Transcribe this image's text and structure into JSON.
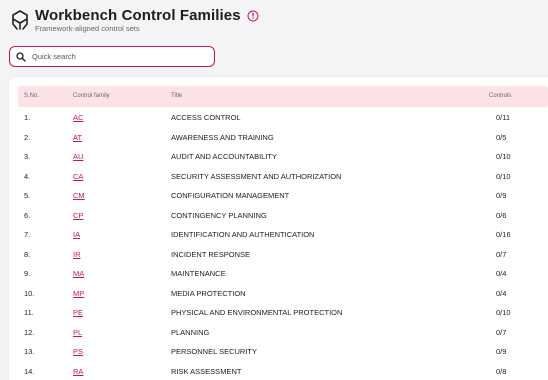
{
  "header": {
    "title": "Workbench Control Families",
    "subtitle": "Framework-aligned control sets"
  },
  "search": {
    "placeholder": "Quick search",
    "value": ""
  },
  "table": {
    "columns": [
      "S.No.",
      "Control family",
      "Title",
      "Controls"
    ],
    "rows": [
      {
        "no": "1.",
        "family": "AC",
        "title": "ACCESS CONTROL",
        "controls": "0/11"
      },
      {
        "no": "2.",
        "family": "AT",
        "title": "AWARENESS AND TRAINING",
        "controls": "0/5"
      },
      {
        "no": "3.",
        "family": "AU",
        "title": "AUDIT AND ACCOUNTABILITY",
        "controls": "0/10"
      },
      {
        "no": "4.",
        "family": "CA",
        "title": "SECURITY ASSESSMENT AND AUTHORIZATION",
        "controls": "0/10"
      },
      {
        "no": "5.",
        "family": "CM",
        "title": "CONFIGURATION MANAGEMENT",
        "controls": "0/9"
      },
      {
        "no": "6.",
        "family": "CP",
        "title": "CONTINGENCY PLANNING",
        "controls": "0/6"
      },
      {
        "no": "7.",
        "family": "IA",
        "title": "IDENTIFICATION AND AUTHENTICATION",
        "controls": "0/16"
      },
      {
        "no": "8.",
        "family": "IR",
        "title": "INCIDENT RESPONSE",
        "controls": "0/7"
      },
      {
        "no": "9.",
        "family": "MA",
        "title": "MAINTENANCE",
        "controls": "0/4"
      },
      {
        "no": "10.",
        "family": "MP",
        "title": "MEDIA PROTECTION",
        "controls": "0/4"
      },
      {
        "no": "11.",
        "family": "PE",
        "title": "PHYSICAL AND ENVIRONMENTAL PROTECTION",
        "controls": "0/10"
      },
      {
        "no": "12.",
        "family": "PL",
        "title": "PLANNING",
        "controls": "0/7"
      },
      {
        "no": "13.",
        "family": "PS",
        "title": "PERSONNEL SECURITY",
        "controls": "0/9"
      },
      {
        "no": "14.",
        "family": "RA",
        "title": "RISK ASSESSMENT",
        "controls": "0/8"
      }
    ]
  },
  "colors": {
    "accent": "#c2185b",
    "header_bg": "#fde3e8"
  },
  "icons": {
    "logo": "workbench-logo-icon",
    "info": "info-icon",
    "search": "search-icon"
  }
}
